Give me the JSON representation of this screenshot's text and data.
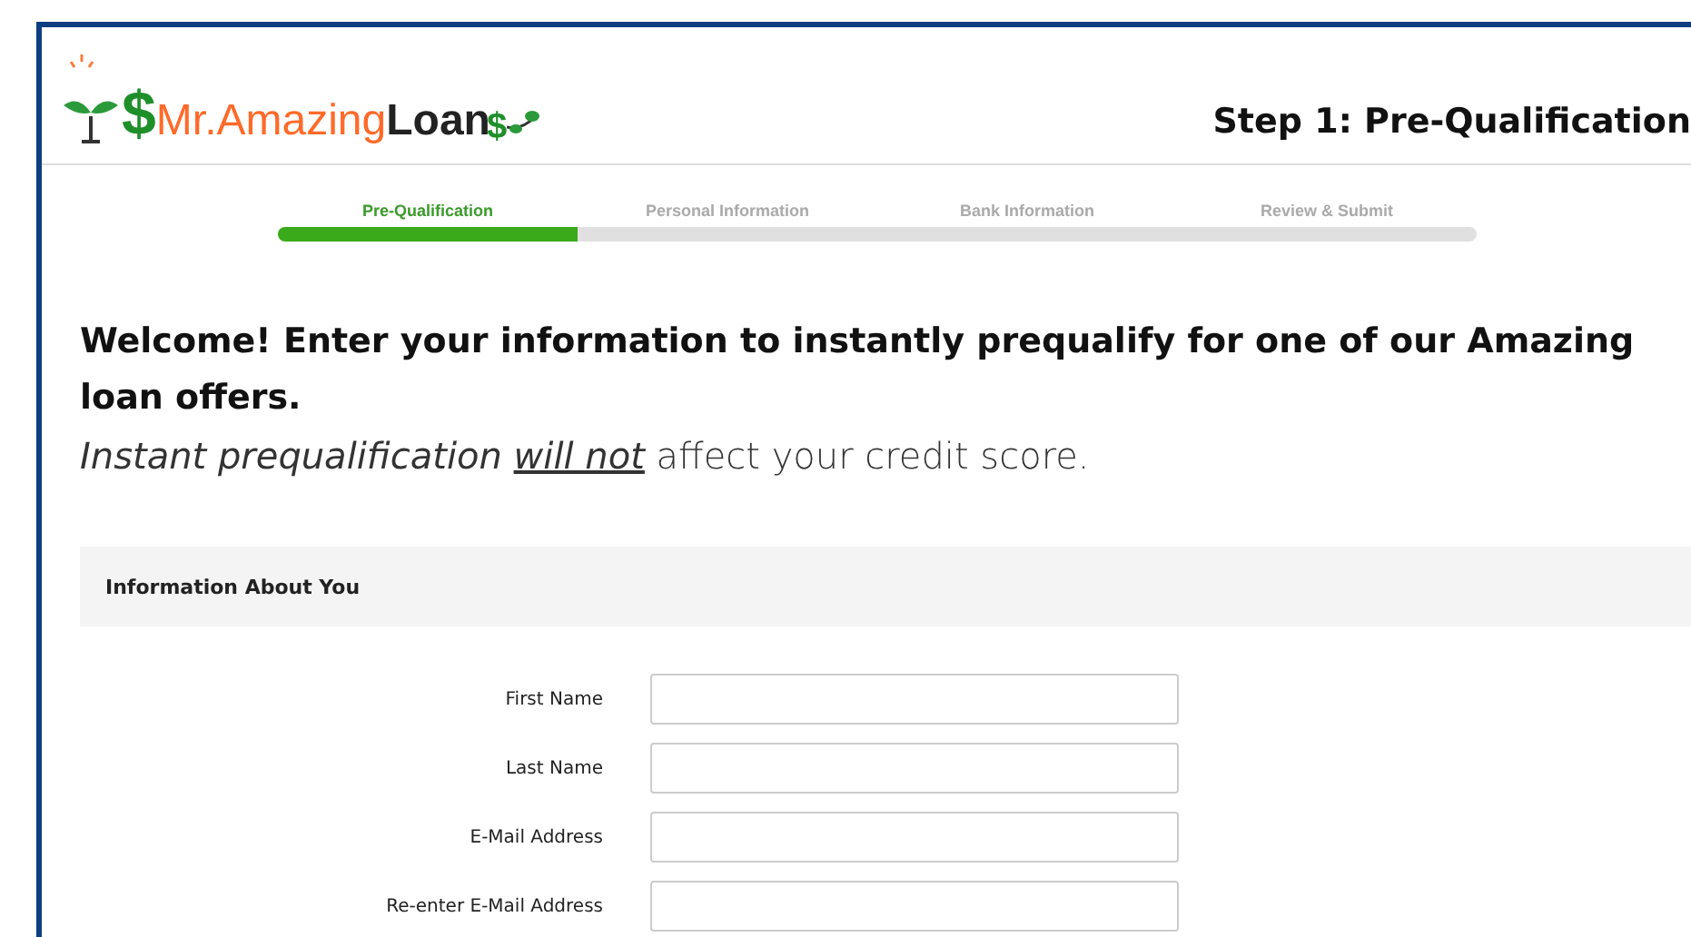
{
  "logo": {
    "symbol": "$",
    "name_accent": "Mr.Amazing",
    "name_dark": "Loan",
    "tail_symbol": "$"
  },
  "page_title": "Step 1: Pre-Qualification",
  "steps": [
    {
      "label": "Pre-Qualification",
      "selected": true
    },
    {
      "label": "Personal Information",
      "selected": false
    },
    {
      "label": "Bank Information",
      "selected": false
    },
    {
      "label": "Review & Submit",
      "selected": false
    }
  ],
  "progress": {
    "level": 0.25
  },
  "heading": "Welcome! Enter your information to instantly prequalify for one of our Amazing loan offers.",
  "subtitle": [
    {
      "text": "Instant prequalification",
      "kind": "italic"
    },
    {
      "text": "will not",
      "kind": "underline"
    },
    {
      "text": "affect your credit score.",
      "kind": "plain"
    }
  ],
  "section": {
    "title": "Information About You"
  },
  "fields": [
    {
      "label": "First Name"
    },
    {
      "label": "Last Name"
    },
    {
      "label": "E-Mail Address"
    },
    {
      "label": "Re-enter E-Mail Address"
    }
  ]
}
